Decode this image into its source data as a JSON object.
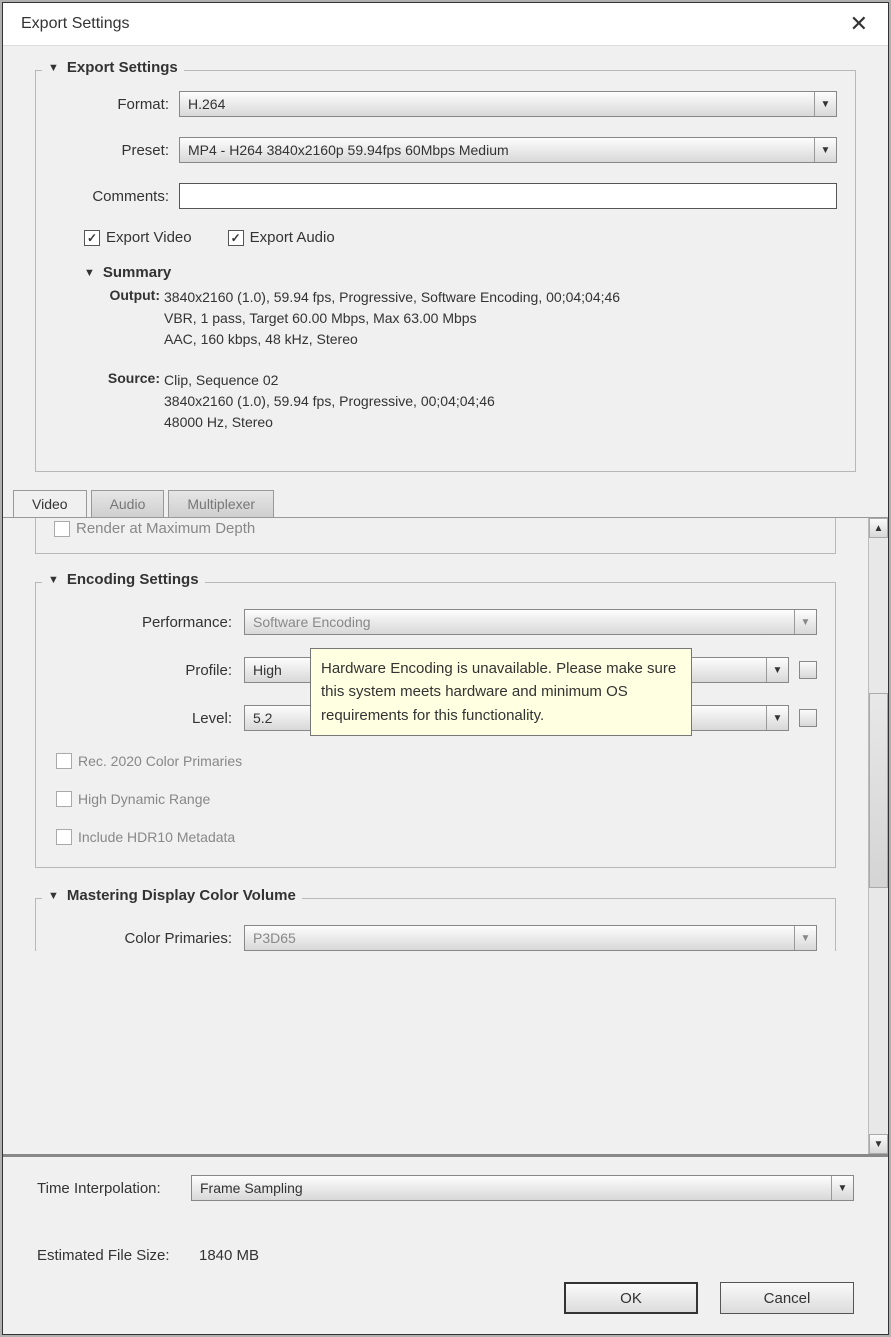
{
  "dialog": {
    "title": "Export Settings"
  },
  "exportSettings": {
    "header": "Export Settings",
    "format_label": "Format:",
    "format_value": "H.264",
    "preset_label": "Preset:",
    "preset_value": "MP4 - H264 3840x2160p 59.94fps 60Mbps Medium",
    "comments_label": "Comments:",
    "comments_value": "",
    "export_video_label": "Export Video",
    "export_video_checked": true,
    "export_audio_label": "Export Audio",
    "export_audio_checked": true
  },
  "summary": {
    "header": "Summary",
    "output_label": "Output:",
    "output_line1": "3840x2160 (1.0), 59.94 fps, Progressive, Software Encoding, 00;04;04;46",
    "output_line2": "VBR, 1 pass, Target 60.00 Mbps, Max 63.00 Mbps",
    "output_line3": "AAC, 160 kbps, 48 kHz, Stereo",
    "source_label": "Source:",
    "source_line1": "Clip, Sequence 02",
    "source_line2": "3840x2160 (1.0), 59.94 fps, Progressive, 00;04;04;46",
    "source_line3": "48000 Hz, Stereo"
  },
  "tabs": {
    "video": "Video",
    "audio": "Audio",
    "multiplexer": "Multiplexer"
  },
  "video": {
    "render_max_depth": "Render at Maximum Depth",
    "encoding_header": "Encoding Settings",
    "performance_label": "Performance:",
    "performance_value": "Software Encoding",
    "profile_label": "Profile:",
    "profile_value": "High",
    "level_label": "Level:",
    "level_value": "5.2",
    "rec2020": "Rec. 2020 Color Primaries",
    "hdr": "High Dynamic Range",
    "hdr10": "Include HDR10 Metadata",
    "tooltip": "Hardware Encoding is unavailable. Please make sure this system meets hardware and minimum OS requirements for this functionality.",
    "mdcv_header": "Mastering Display Color Volume",
    "color_primaries_label": "Color Primaries:",
    "color_primaries_value": "P3D65"
  },
  "footer": {
    "time_interp_label": "Time Interpolation:",
    "time_interp_value": "Frame Sampling",
    "efs_label": "Estimated File Size:",
    "efs_value": "1840 MB",
    "ok": "OK",
    "cancel": "Cancel"
  }
}
